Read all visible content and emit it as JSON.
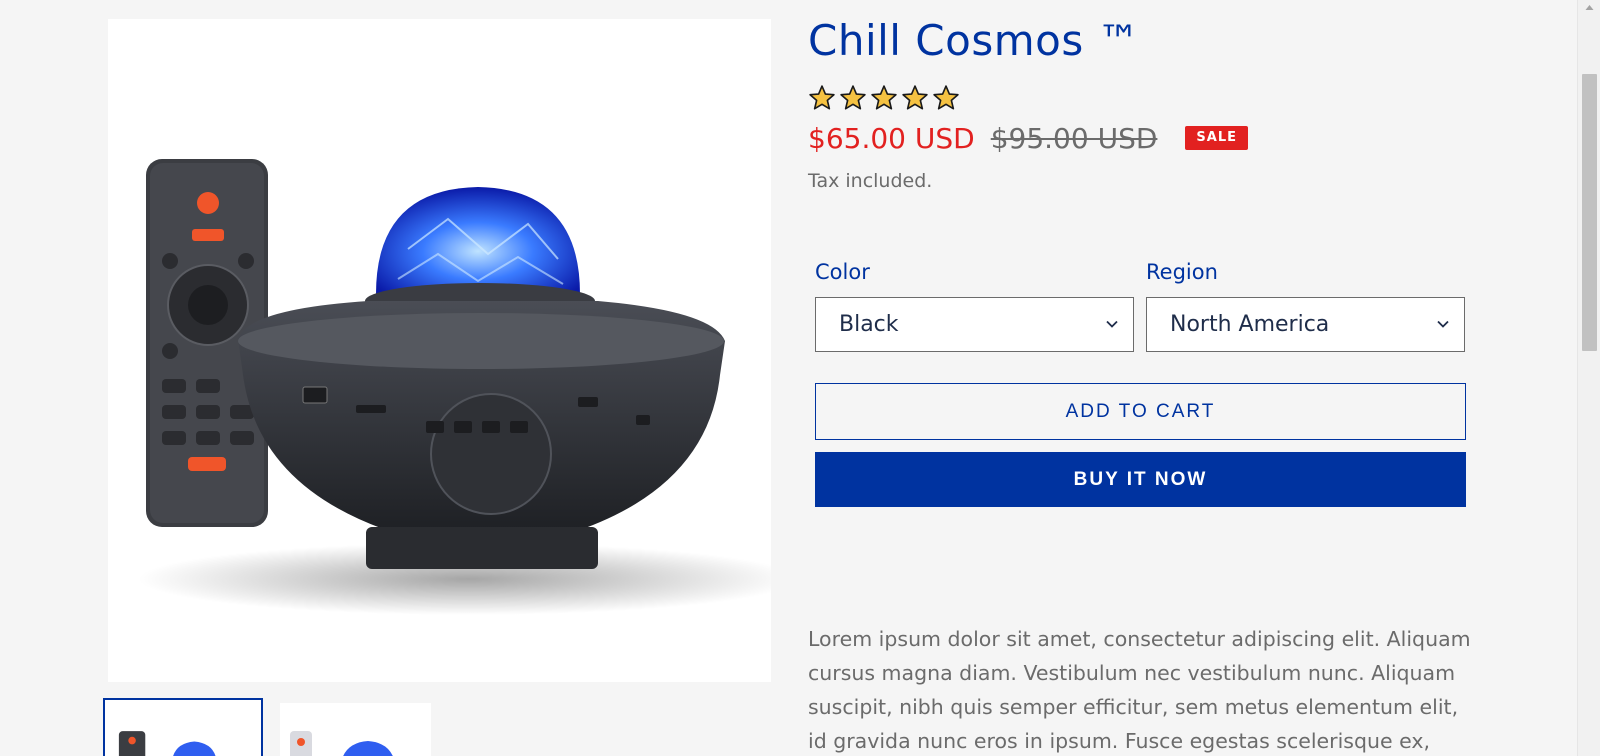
{
  "product": {
    "title": "Chill Cosmos ™",
    "rating_stars": 5,
    "sale_price": "$65.00 USD",
    "compare_price": "$95.00 USD",
    "sale_badge": "SALE",
    "tax_note": "Tax included."
  },
  "options": [
    {
      "label": "Color",
      "value": "Black"
    },
    {
      "label": "Region",
      "value": "North America"
    }
  ],
  "buttons": {
    "add_to_cart": "ADD TO CART",
    "buy_now": "BUY IT NOW"
  },
  "description": "Lorem ipsum dolor sit amet, consectetur adipiscing elit. Aliquam cursus magna diam. Vestibulum nec vestibulum nunc. Aliquam suscipit, nibh quis semper efficitur, sem metus elementum elit, id gravida nunc eros in ipsum. Fusce egestas scelerisque ex,",
  "colors": {
    "brand_blue": "#0033a0",
    "sale_red": "#e22120",
    "muted_text": "#6b6b6b",
    "star_fill": "#f5c242"
  },
  "icons": {
    "rating": "star-icon",
    "dropdown": "chevron-down-icon"
  }
}
